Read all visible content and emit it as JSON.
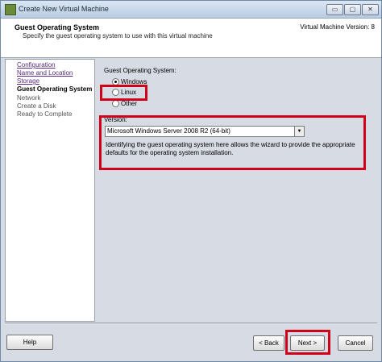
{
  "window": {
    "title": "Create New Virtual Machine",
    "min_label": "▭",
    "max_label": "▢",
    "close_label": "✕"
  },
  "header": {
    "title": "Guest Operating System",
    "subtitle": "Specify the guest operating system to use with this virtual machine",
    "vm_version": "Virtual Machine Version: 8"
  },
  "sidebar": {
    "items": [
      {
        "label": "Configuration",
        "state": "link"
      },
      {
        "label": "Name and Location",
        "state": "link"
      },
      {
        "label": "Storage",
        "state": "link"
      },
      {
        "label": "Guest Operating System",
        "state": "current"
      },
      {
        "label": "Network",
        "state": "future"
      },
      {
        "label": "Create a Disk",
        "state": "future"
      },
      {
        "label": "Ready to Complete",
        "state": "future"
      }
    ]
  },
  "main": {
    "group_label": "Guest Operating System:",
    "os_options": [
      {
        "label": "Windows",
        "selected": true
      },
      {
        "label": "Linux",
        "selected": false
      },
      {
        "label": "Other",
        "selected": false
      }
    ],
    "version_label": "Version:",
    "version_value": "Microsoft Windows Server 2008 R2 (64-bit)",
    "description": "Identifying the guest operating system here allows the wizard to provide the appropriate defaults for the operating system installation."
  },
  "footer": {
    "help_label": "Help",
    "back_label": "< Back",
    "next_label": "Next >",
    "cancel_label": "Cancel"
  },
  "colors": {
    "highlight": "#d0021b",
    "link": "#5a2d82",
    "panel": "#d6dbe4"
  }
}
